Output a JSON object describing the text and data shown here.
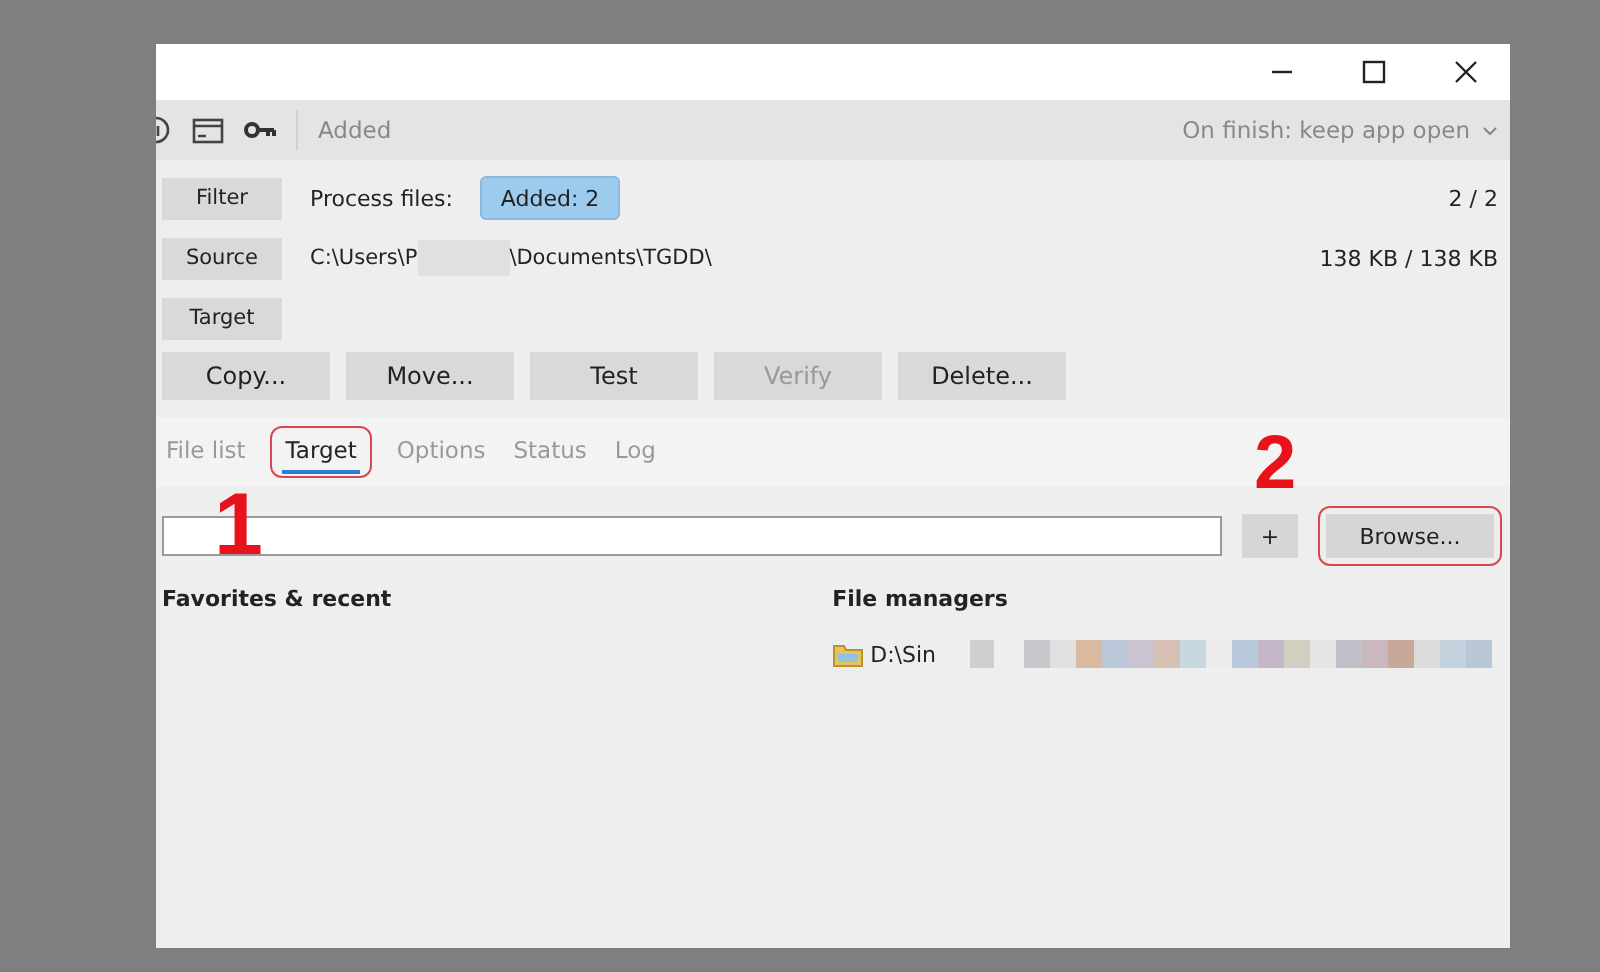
{
  "toolbar": {
    "status": "Added",
    "on_finish": "On finish: keep app open"
  },
  "filter": {
    "button": "Filter",
    "label": "Process files:",
    "badge": "Added: 2",
    "count": "2 / 2"
  },
  "source": {
    "button": "Source",
    "path_start": "C:\\Users\\P",
    "path_end": "\\Documents\\TGDD\\",
    "size": "138 KB / 138 KB"
  },
  "target": {
    "button": "Target"
  },
  "actions": [
    {
      "label": "Copy...",
      "disabled": false
    },
    {
      "label": "Move...",
      "disabled": false
    },
    {
      "label": "Test",
      "disabled": false
    },
    {
      "label": "Verify",
      "disabled": true
    },
    {
      "label": "Delete...",
      "disabled": false
    }
  ],
  "tabs": [
    {
      "label": "File list",
      "selected": false
    },
    {
      "label": "Target",
      "selected": true
    },
    {
      "label": "Options",
      "selected": false
    },
    {
      "label": "Status",
      "selected": false
    },
    {
      "label": "Log",
      "selected": false
    }
  ],
  "target_panel": {
    "add_button": "+",
    "browse_button": "Browse...",
    "favorites_heading": "Favorites & recent",
    "managers_heading": "File managers",
    "managers": [
      {
        "label": "D:\\Sin"
      }
    ]
  },
  "annotations": [
    {
      "label": "1"
    },
    {
      "label": "2"
    }
  ]
}
